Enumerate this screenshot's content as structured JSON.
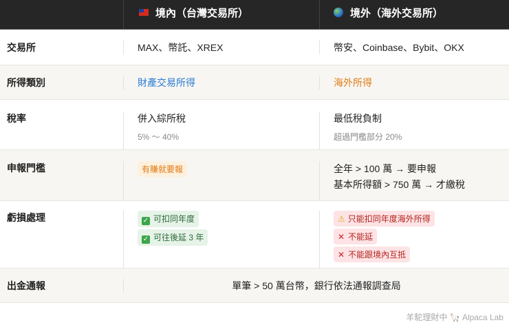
{
  "header": {
    "col_domestic": "境內（台灣交易所）",
    "col_foreign": "境外（海外交易所）",
    "domestic_icon": "taiwan-flag-icon",
    "foreign_icon": "globe-icon"
  },
  "rows": {
    "exchange": {
      "label": "交易所",
      "domestic": "MAX、幣託、XREX",
      "foreign": "幣安、Coinbase、Bybit、OKX"
    },
    "income_type": {
      "label": "所得類別",
      "domestic": "財產交易所得",
      "foreign": "海外所得",
      "domestic_color": "#2b7bd6",
      "foreign_color": "#e07b15"
    },
    "tax_rate": {
      "label": "稅率",
      "domestic": "併入綜所稅",
      "domestic_sub": "5% ～ 40%",
      "foreign": "最低稅負制",
      "foreign_sub": "超過門檻部分 20%"
    },
    "threshold": {
      "label": "申報門檻",
      "domestic": "有賺就要報",
      "foreign_line1": "全年 > 100 萬 → 要申報",
      "foreign_line2": "基本所得額 > 750 萬 → 才繳稅"
    },
    "loss": {
      "label": "虧損處理",
      "domestic": [
        "可扣同年度",
        "可往後延 3 年"
      ],
      "foreign": [
        "只能扣同年度海外所得",
        "不能延",
        "不能跟境內互抵"
      ]
    },
    "withdrawal": {
      "label": "出金通報",
      "value": "單筆 > 50 萬台幣，銀行依法通報調查局"
    }
  },
  "footer": "羊駝理財中 🦙 Alpaca Lab"
}
